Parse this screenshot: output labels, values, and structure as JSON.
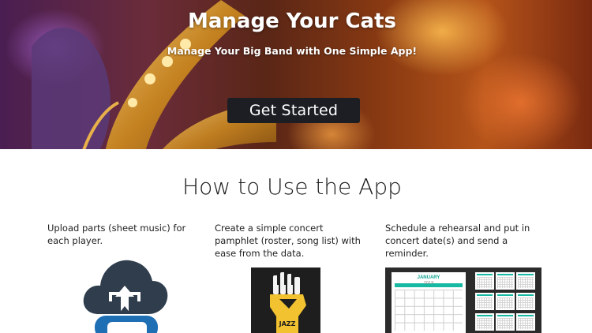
{
  "hero": {
    "title": "Manage Your Cats",
    "subtitle": "Manage Your Big Band with One Simple App!",
    "cta_label": "Get Started"
  },
  "how_to": {
    "title": "How to Use the App",
    "steps": [
      {
        "text": "Upload parts (sheet music) for each player.",
        "icon": "cloud-upload-icon"
      },
      {
        "text": "Create a simple concert pamphlet (roster, song list) with ease from the data.",
        "icon": "jazz-fist-icon"
      },
      {
        "text": "Schedule a rehearsal and put in concert date(s) and send a reminder.",
        "icon": "calendar-image"
      }
    ]
  },
  "calendar": {
    "month": "JANUARY",
    "year": "2019"
  },
  "poster": {
    "label": "JAZZ"
  },
  "colors": {
    "cta_bg": "#1c1e24",
    "cloud": "#2f3d4c",
    "arrow_blue": "#1f6fb5",
    "calendar_accent": "#18b9a3",
    "fist_yellow": "#f2c230"
  }
}
